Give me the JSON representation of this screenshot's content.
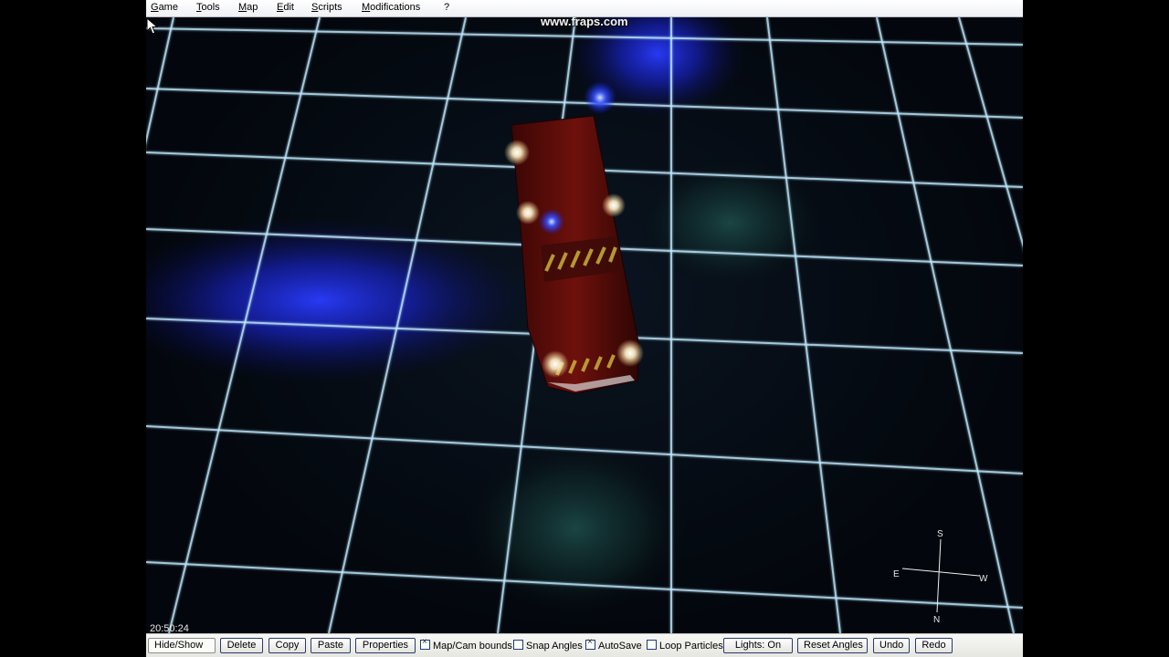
{
  "menu": {
    "items": [
      "Game",
      "Tools",
      "Map",
      "Edit",
      "Scripts",
      "Modifications",
      "?"
    ]
  },
  "viewport": {
    "watermark": "www.fraps.com",
    "clock": "20:50:24",
    "compass": {
      "north": "N",
      "south": "S",
      "east": "E",
      "west": "W"
    }
  },
  "toolbar": {
    "hide_show": "Hide/Show",
    "delete": "Delete",
    "copy": "Copy",
    "paste": "Paste",
    "properties": "Properties",
    "map_cam_bounds": "Map/Cam bounds",
    "snap_angles": "Snap Angles",
    "autosave": "AutoSave",
    "loop_particles": "Loop Particles",
    "lights": "Lights: On",
    "reset_angles": "Reset Angles",
    "undo": "Undo",
    "redo": "Redo"
  },
  "checkbox_state": {
    "map_cam_bounds": true,
    "snap_angles": false,
    "autosave": true,
    "loop_particles": false
  },
  "colors": {
    "grid_line": "#bfeaff",
    "police_blue": "#1e32ff",
    "vehicle_red": "#6a0d0a",
    "headlight": "#fff6d8"
  }
}
